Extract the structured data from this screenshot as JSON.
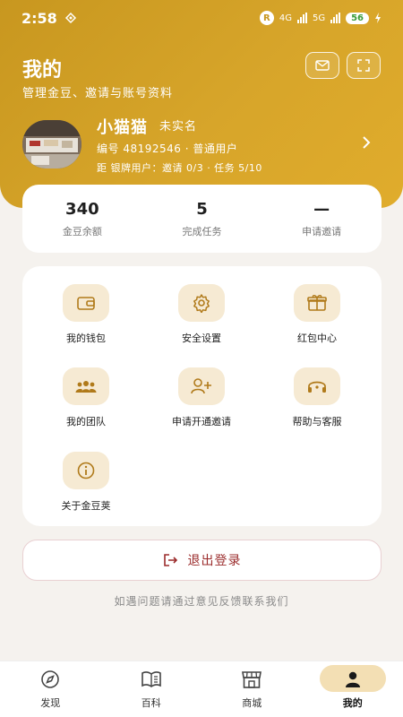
{
  "status_bar": {
    "time": "2:58",
    "r_badge": "R",
    "net1": "4G",
    "net2": "5G",
    "battery": "56"
  },
  "header": {
    "title": "我的",
    "subtitle": "管理金豆、邀请与账号资料",
    "mail_icon": "mail-icon",
    "fullscreen_icon": "expand-icon"
  },
  "user": {
    "name": "小猫猫",
    "verify_status": "未实名",
    "meta": "编号 48192546 · 普通用户",
    "progress": "距 银牌用户：邀请 0/3 · 任务 5/10"
  },
  "stats": [
    {
      "value": "340",
      "label": "金豆余额"
    },
    {
      "value": "5",
      "label": "完成任务"
    },
    {
      "value": "—",
      "label": "申请邀请"
    }
  ],
  "menu": [
    {
      "label": "我的钱包",
      "icon": "wallet-icon"
    },
    {
      "label": "安全设置",
      "icon": "gear-icon"
    },
    {
      "label": "红包中心",
      "icon": "gift-icon"
    },
    {
      "label": "我的团队",
      "icon": "team-icon"
    },
    {
      "label": "申请开通邀请",
      "icon": "add-user-icon"
    },
    {
      "label": "帮助与客服",
      "icon": "headset-icon"
    },
    {
      "label": "关于金豆荚",
      "icon": "info-icon"
    }
  ],
  "logout": {
    "label": "退出登录"
  },
  "feedback_text": "如遇问题请通过意见反馈联系我们",
  "nav": [
    {
      "label": "发现",
      "icon": "compass-icon"
    },
    {
      "label": "百科",
      "icon": "book-icon"
    },
    {
      "label": "商城",
      "icon": "store-icon"
    },
    {
      "label": "我的",
      "icon": "user-icon",
      "active": true
    }
  ],
  "colors": {
    "brand_gold": "#d4a128",
    "icon_bg": "#f6ead3",
    "icon_stroke": "#b07a1a",
    "logout_red": "#9b2c2c"
  }
}
